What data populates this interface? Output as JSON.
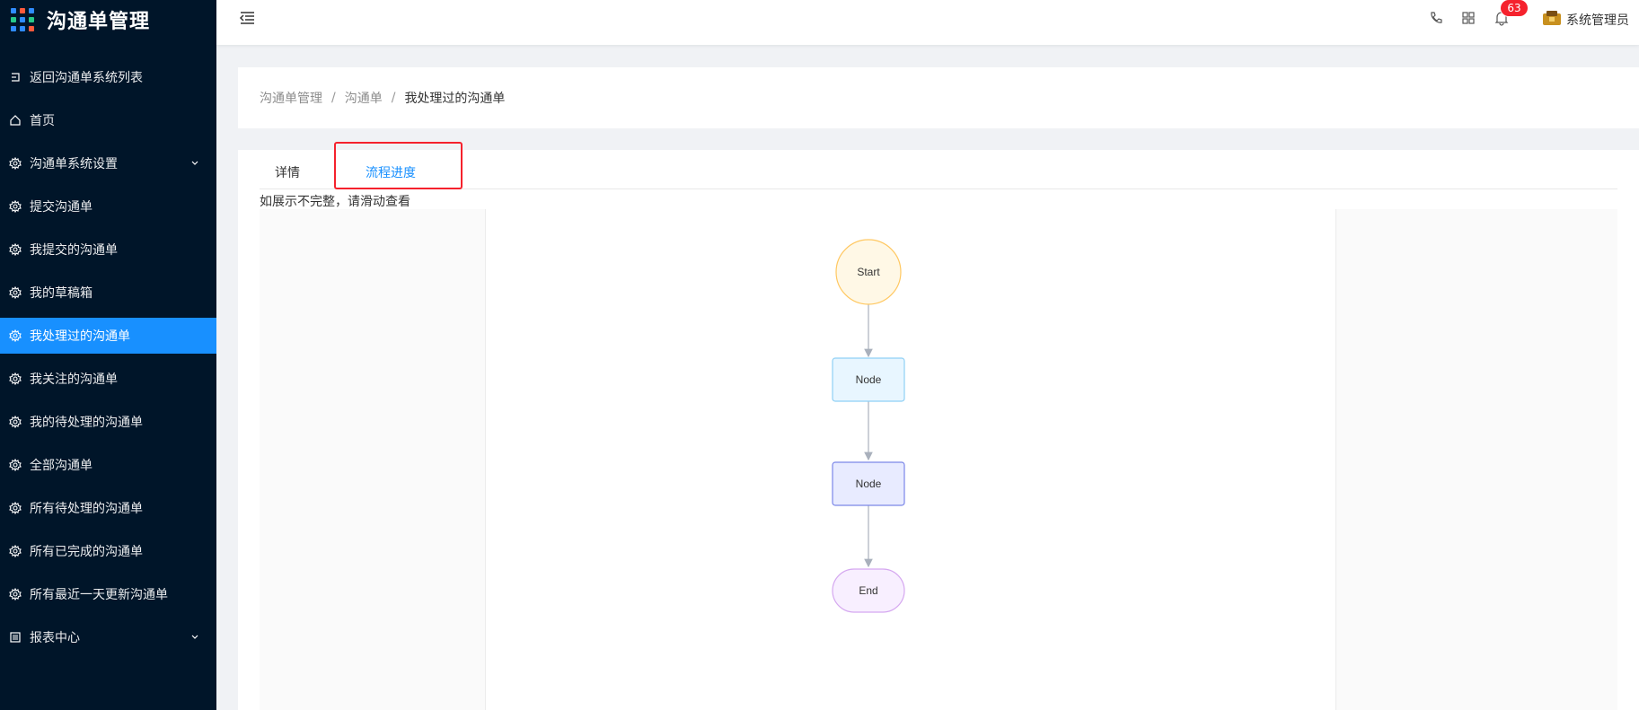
{
  "app": {
    "title": "沟通单管理"
  },
  "sidebar": {
    "items": [
      {
        "label": "返回沟通单系统列表",
        "icon": "return-icon"
      },
      {
        "label": "首页",
        "icon": "home-icon"
      },
      {
        "label": "沟通单系统设置",
        "icon": "gear-icon",
        "expandable": true
      },
      {
        "label": "提交沟通单",
        "icon": "gear-icon"
      },
      {
        "label": "我提交的沟通单",
        "icon": "gear-icon"
      },
      {
        "label": "我的草稿箱",
        "icon": "gear-icon"
      },
      {
        "label": "我处理过的沟通单",
        "icon": "gear-icon",
        "active": true
      },
      {
        "label": "我关注的沟通单",
        "icon": "gear-icon"
      },
      {
        "label": "我的待处理的沟通单",
        "icon": "gear-icon"
      },
      {
        "label": "全部沟通单",
        "icon": "gear-icon"
      },
      {
        "label": "所有待处理的沟通单",
        "icon": "gear-icon"
      },
      {
        "label": "所有已完成的沟通单",
        "icon": "gear-icon"
      },
      {
        "label": "所有最近一天更新沟通单",
        "icon": "gear-icon"
      },
      {
        "label": "报表中心",
        "icon": "report-icon",
        "expandable": true
      }
    ]
  },
  "header": {
    "notification_count": "63",
    "user_name": "系统管理员",
    "icons": [
      "menu-fold-icon",
      "phone-icon",
      "grid-icon",
      "bell-icon",
      "avatar"
    ]
  },
  "breadcrumb": {
    "items": [
      "沟通单管理",
      "沟通单",
      "我处理过的沟通单"
    ]
  },
  "tabs": {
    "items": [
      "详情",
      "流程进度"
    ],
    "active": "流程进度"
  },
  "hint": "如展示不完整，请滑动查看",
  "flow": {
    "nodes": [
      {
        "label": "Start",
        "shape": "circle",
        "fill": "#fff8e6",
        "stroke": "#ffc862"
      },
      {
        "label": "Node",
        "shape": "rect",
        "fill": "#e8f6ff",
        "stroke": "#8fd0f5"
      },
      {
        "label": "Node",
        "shape": "rect",
        "fill": "#e8ebff",
        "stroke": "#7b86e8"
      },
      {
        "label": "End",
        "shape": "pill",
        "fill": "#f8efff",
        "stroke": "#d5a8f0"
      }
    ]
  },
  "colors": {
    "sidebar_bg": "#001529",
    "accent": "#1890ff",
    "badge": "#f5222d"
  }
}
